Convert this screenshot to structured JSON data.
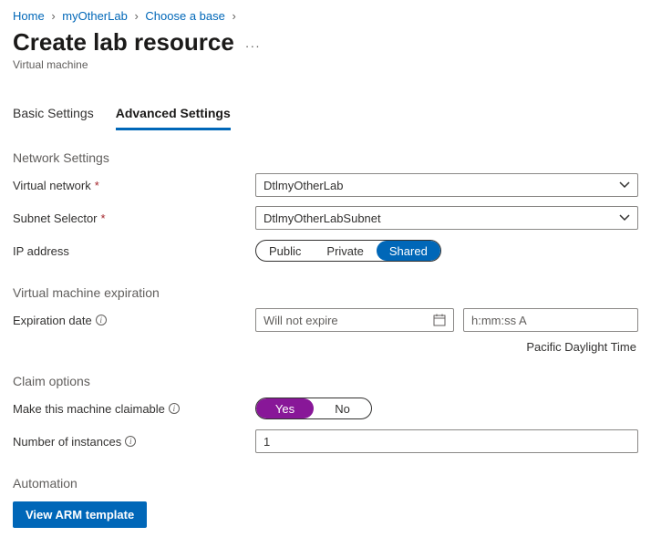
{
  "breadcrumb": {
    "items": [
      "Home",
      "myOtherLab",
      "Choose a base"
    ]
  },
  "header": {
    "title": "Create lab resource",
    "subtitle": "Virtual machine"
  },
  "tabs": {
    "basic": "Basic Settings",
    "advanced": "Advanced Settings"
  },
  "sections": {
    "network": "Network Settings",
    "vm_exp": "Virtual machine expiration",
    "claim": "Claim options",
    "automation": "Automation"
  },
  "fields": {
    "vnet_label": "Virtual network",
    "vnet_value": "DtlmyOtherLab",
    "subnet_label": "Subnet Selector",
    "subnet_value": "DtlmyOtherLabSubnet",
    "ip_label": "IP address",
    "ip_options": {
      "public": "Public",
      "private": "Private",
      "shared": "Shared"
    },
    "exp_label": "Expiration date",
    "exp_placeholder": "Will not expire",
    "time_placeholder": "h:mm:ss A",
    "timezone": "Pacific Daylight Time",
    "claim_label": "Make this machine claimable",
    "claim_yes": "Yes",
    "claim_no": "No",
    "instances_label": "Number of instances",
    "instances_value": "1"
  },
  "buttons": {
    "view_arm": "View ARM template"
  },
  "info_glyph": "i"
}
